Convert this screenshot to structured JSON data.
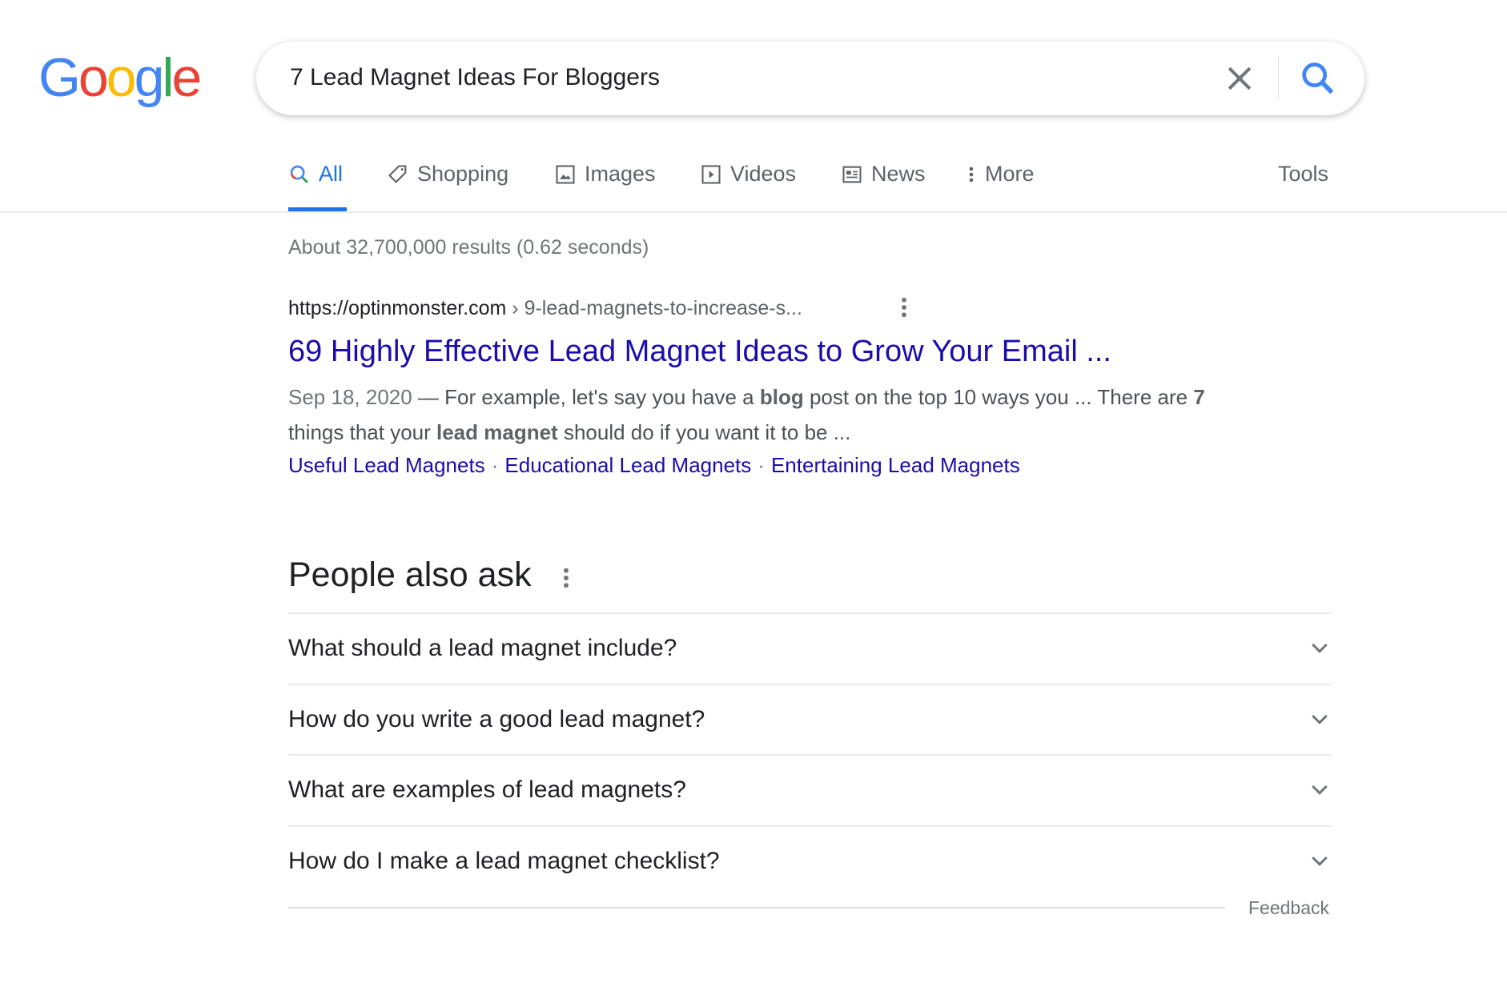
{
  "logo": {
    "text": "Google",
    "colors": [
      "#4285f4",
      "#ea4335",
      "#fbbc05",
      "#4285f4",
      "#34a853",
      "#ea4335"
    ]
  },
  "search": {
    "query": "7 Lead Magnet Ideas For Bloggers",
    "clear_icon": "close-icon",
    "search_icon": "search-icon"
  },
  "tabs": [
    {
      "label": "All",
      "icon": "search-icon",
      "active": true
    },
    {
      "label": "Shopping",
      "icon": "tag-icon"
    },
    {
      "label": "Images",
      "icon": "image-icon"
    },
    {
      "label": "Videos",
      "icon": "play-icon"
    },
    {
      "label": "News",
      "icon": "newspaper-icon"
    },
    {
      "label": "More",
      "icon": "more-vert-icon"
    }
  ],
  "tools_label": "Tools",
  "stats": "About 32,700,000 results (0.62 seconds)",
  "result": {
    "url_domain": "https://optinmonster.com",
    "url_path": " › 9-lead-magnets-to-increase-s...",
    "title": "69 Highly Effective Lead Magnet Ideas to Grow Your Email ...",
    "date": "Sep 18, 2020",
    "snippet": [
      {
        "t": " — For example, let's say you have a "
      },
      {
        "b": "blog"
      },
      {
        "t": " post on the top 10 ways you ... There are "
      },
      {
        "b": "7"
      },
      {
        "t": " things that your "
      },
      {
        "b": "lead magnet"
      },
      {
        "t": " should do if you want it to be ..."
      }
    ],
    "sitelinks": [
      "Useful Lead Magnets",
      "Educational Lead Magnets",
      "Entertaining Lead Magnets"
    ]
  },
  "paa": {
    "heading": "People also ask",
    "questions": [
      "What should a lead magnet include?",
      "How do you write a good lead magnet?",
      "What are examples of lead magnets?",
      "How do I make a lead magnet checklist?"
    ],
    "feedback": "Feedback"
  },
  "colors": {
    "link": "#1a0dab",
    "accent": "#1a73e8"
  }
}
